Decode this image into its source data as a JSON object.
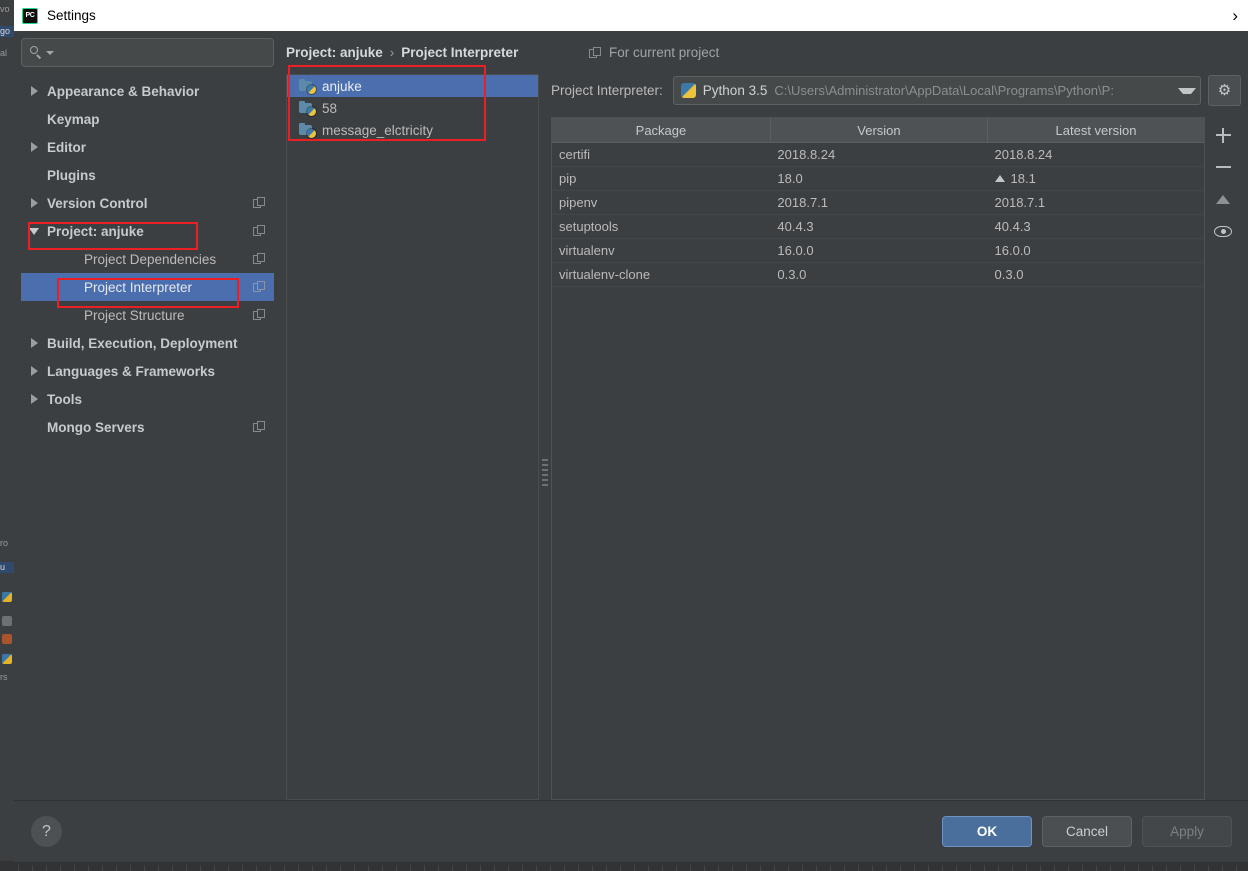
{
  "window": {
    "title": "Settings",
    "app_icon": "pycharm-icon",
    "title_chevron": "›"
  },
  "search": {
    "value": "",
    "placeholder": ""
  },
  "sidebar": {
    "items": [
      {
        "label": "Appearance & Behavior",
        "twisty": "right",
        "bold": true,
        "child": false,
        "badge": false,
        "selected": false
      },
      {
        "label": "Keymap",
        "twisty": "none",
        "bold": true,
        "child": false,
        "badge": false,
        "selected": false
      },
      {
        "label": "Editor",
        "twisty": "right",
        "bold": true,
        "child": false,
        "badge": false,
        "selected": false
      },
      {
        "label": "Plugins",
        "twisty": "none",
        "bold": true,
        "child": false,
        "badge": false,
        "selected": false
      },
      {
        "label": "Version Control",
        "twisty": "right",
        "bold": true,
        "child": false,
        "badge": true,
        "selected": false
      },
      {
        "label": "Project: anjuke",
        "twisty": "down",
        "bold": true,
        "child": false,
        "badge": true,
        "selected": false
      },
      {
        "label": "Project Dependencies",
        "twisty": "none",
        "bold": false,
        "child": true,
        "badge": true,
        "selected": false
      },
      {
        "label": "Project Interpreter",
        "twisty": "none",
        "bold": false,
        "child": true,
        "badge": true,
        "selected": true
      },
      {
        "label": "Project Structure",
        "twisty": "none",
        "bold": false,
        "child": true,
        "badge": true,
        "selected": false
      },
      {
        "label": "Build, Execution, Deployment",
        "twisty": "right",
        "bold": true,
        "child": false,
        "badge": false,
        "selected": false
      },
      {
        "label": "Languages & Frameworks",
        "twisty": "right",
        "bold": true,
        "child": false,
        "badge": false,
        "selected": false
      },
      {
        "label": "Tools",
        "twisty": "right",
        "bold": true,
        "child": false,
        "badge": false,
        "selected": false
      },
      {
        "label": "Mongo Servers",
        "twisty": "none",
        "bold": true,
        "child": false,
        "badge": true,
        "selected": false
      }
    ]
  },
  "breadcrumb": {
    "parent": "Project: anjuke",
    "separator": "›",
    "current": "Project Interpreter"
  },
  "project_list": {
    "items": [
      {
        "label": "anjuke",
        "selected": true
      },
      {
        "label": "58",
        "selected": false
      },
      {
        "label": "message_elctricity",
        "selected": false
      }
    ]
  },
  "scope_note": {
    "label": "For current project",
    "icon": "copy-icon"
  },
  "interpreter": {
    "label": "Project Interpreter:",
    "name": "Python 3.5",
    "path": "C:\\Users\\Administrator\\AppData\\Local\\Programs\\Python\\P:",
    "icon": "python-icon",
    "dropdown_icon": "chevron-down-icon",
    "gear_icon": "gear-icon",
    "gear_glyph": "⚙"
  },
  "packages": {
    "columns": [
      "Package",
      "Version",
      "Latest version"
    ],
    "rows": [
      {
        "package": "certifi",
        "version": "2018.8.24",
        "latest": "2018.8.24",
        "upgradable": false
      },
      {
        "package": "pip",
        "version": "18.0",
        "latest": "18.1",
        "upgradable": true
      },
      {
        "package": "pipenv",
        "version": "2018.7.1",
        "latest": "2018.7.1",
        "upgradable": false
      },
      {
        "package": "setuptools",
        "version": "40.4.3",
        "latest": "40.4.3",
        "upgradable": false
      },
      {
        "package": "virtualenv",
        "version": "16.0.0",
        "latest": "16.0.0",
        "upgradable": false
      },
      {
        "package": "virtualenv-clone",
        "version": "0.3.0",
        "latest": "0.3.0",
        "upgradable": false
      }
    ],
    "toolbar": [
      {
        "icon": "plus-icon",
        "name": "add-package-button"
      },
      {
        "icon": "minus-icon",
        "name": "remove-package-button"
      },
      {
        "icon": "arrow-up-icon",
        "name": "upgrade-package-button"
      },
      {
        "icon": "eye-icon",
        "name": "show-paths-button"
      }
    ]
  },
  "footer": {
    "help_label": "?",
    "ok_label": "OK",
    "cancel_label": "Cancel",
    "apply_label": "Apply",
    "apply_disabled": true
  },
  "colors": {
    "window_bg": "#3c3f41",
    "selection_blue": "#4b6eaf",
    "annotation_red": "#ec2024",
    "title_bar": "#ffffff",
    "primary_button": "#4a6f9c"
  },
  "background_ide": {
    "fragments": [
      "vo",
      "go",
      "al",
      "ro",
      "u",
      "rs"
    ]
  }
}
